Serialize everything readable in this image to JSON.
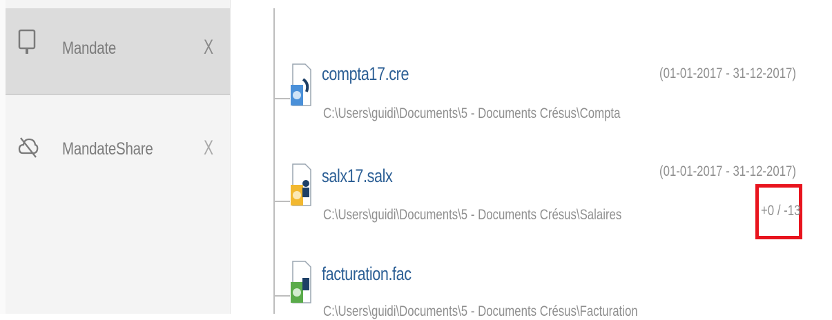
{
  "sidebar": {
    "items": [
      {
        "label": "Mandate",
        "icon": "monitor-icon",
        "close": "X",
        "active": true
      },
      {
        "label": "MandateShare",
        "icon": "cloud-off-icon",
        "close": "X",
        "active": false
      }
    ]
  },
  "files": [
    {
      "name": "compta17.cre",
      "path": "C:\\Users\\guidi\\Documents\\5 - Documents Crésus\\Compta",
      "dates": "(01-01-2017 - 31-12-2017)",
      "icon": "cresus-compta-icon",
      "accent": "#4a90d9"
    },
    {
      "name": "salx17.salx",
      "path": "C:\\Users\\guidi\\Documents\\5 - Documents Crésus\\Salaires",
      "dates": "(01-01-2017 - 31-12-2017)",
      "diff": "+0 / -13",
      "icon": "cresus-salaires-icon",
      "accent": "#f2b830"
    },
    {
      "name": "facturation.fac",
      "path": "C:\\Users\\guidi\\Documents\\5 - Documents Crésus\\Facturation",
      "icon": "cresus-facturation-icon",
      "accent": "#5aab4a"
    }
  ],
  "colors": {
    "link": "#2c5f95",
    "highlight": "#e8141e",
    "sidebar_active": "#dcdcdc"
  }
}
